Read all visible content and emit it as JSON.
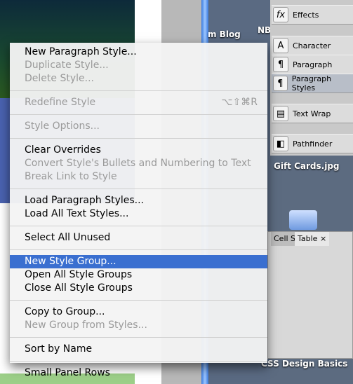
{
  "background": {
    "desktop_labels": [
      "NB",
      "m Blog",
      "Gift Cards.jpg",
      "CSS Design Basics"
    ]
  },
  "panel_dock": {
    "items": [
      {
        "label": "Effects",
        "icon": "fx-icon"
      },
      {
        "label": "Character",
        "icon": "character-icon"
      },
      {
        "label": "Paragraph",
        "icon": "pilcrow-icon"
      },
      {
        "label": "Paragraph Styles",
        "icon": "paragraph-styles-icon",
        "active": true
      },
      {
        "label": "Text Wrap",
        "icon": "text-wrap-icon"
      },
      {
        "label": "Pathfinder",
        "icon": "pathfinder-icon"
      }
    ]
  },
  "cell_panel": {
    "tabs": [
      "Cell St",
      "Table"
    ]
  },
  "menu": {
    "highlight_color": "#3a6fd0",
    "groups": [
      [
        {
          "label": "New Paragraph Style...",
          "enabled": true
        },
        {
          "label": "Duplicate Style...",
          "enabled": false
        },
        {
          "label": "Delete Style...",
          "enabled": false
        }
      ],
      [
        {
          "label": "Redefine Style",
          "enabled": false,
          "shortcut": "⌥⇧⌘R"
        }
      ],
      [
        {
          "label": "Style Options...",
          "enabled": false
        }
      ],
      [
        {
          "label": "Clear Overrides",
          "enabled": true
        },
        {
          "label": "Convert Style's Bullets and Numbering to Text",
          "enabled": false
        },
        {
          "label": "Break Link to Style",
          "enabled": false
        }
      ],
      [
        {
          "label": "Load Paragraph Styles...",
          "enabled": true
        },
        {
          "label": "Load All Text Styles...",
          "enabled": true
        }
      ],
      [
        {
          "label": "Select All Unused",
          "enabled": true
        }
      ],
      [
        {
          "label": "New Style Group...",
          "enabled": true,
          "highlighted": true
        },
        {
          "label": "Open All Style Groups",
          "enabled": true
        },
        {
          "label": "Close All Style Groups",
          "enabled": true
        }
      ],
      [
        {
          "label": "Copy to Group...",
          "enabled": true
        },
        {
          "label": "New Group from Styles...",
          "enabled": false
        }
      ],
      [
        {
          "label": "Sort by Name",
          "enabled": true
        }
      ],
      [
        {
          "label": "Small Panel Rows",
          "enabled": true
        }
      ]
    ]
  }
}
